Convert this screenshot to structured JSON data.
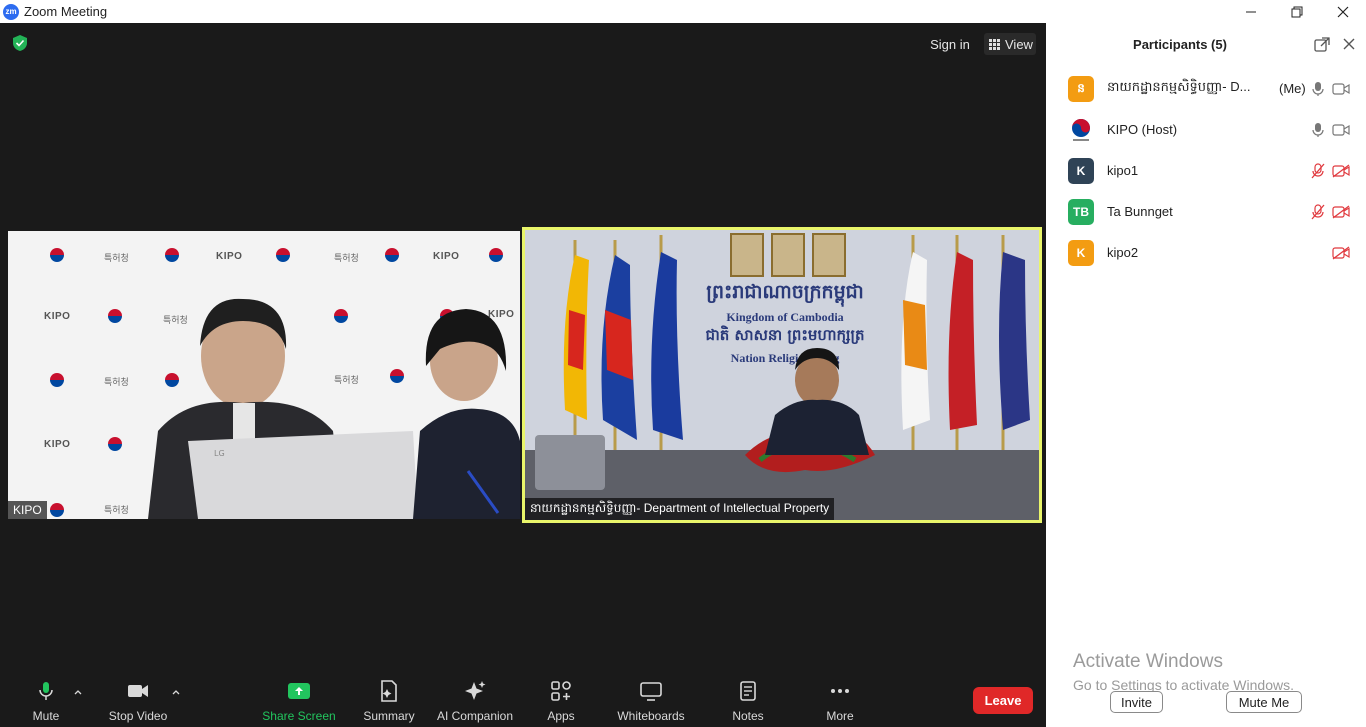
{
  "window": {
    "title": "Zoom Meeting",
    "logo_text": "zm"
  },
  "header": {
    "signin_label": "Sign in",
    "view_label": "View"
  },
  "videos": {
    "left_name": "KIPO",
    "left_backdrop_text": "KIPO",
    "left_backdrop_korean": "특허청",
    "right_name": "នាយកដ្ឋានកម្មសិទ្ធិបញ្ញា- Department of Intellectual Property",
    "right_backdrop_khmer": "ព្រះរាជាណាចក្រកម្ពុជា",
    "right_backdrop_line1": "Kingdom of Cambodia",
    "right_backdrop_khmer2": "ជាតិ សាសនា ព្រះមហាក្សត្រ",
    "right_backdrop_line2": "Nation Religion King",
    "active_speaker_color": "#e9f56a"
  },
  "toolbar": {
    "mute_label": "Mute",
    "stop_video_label": "Stop Video",
    "share_screen_label": "Share Screen",
    "summary_label": "Summary",
    "ai_companion_label": "AI Companion",
    "apps_label": "Apps",
    "whiteboards_label": "Whiteboards",
    "notes_label": "Notes",
    "more_label": "More",
    "leave_label": "Leave",
    "share_color": "#22c55e",
    "leave_color": "#e02828"
  },
  "participants_panel": {
    "title": "Participants (5)",
    "participants": [
      {
        "name": "នាយកដ្ឋានកម្មសិទ្ធិបញ្ញា- D...",
        "tag": "(Me)",
        "avatar": "ន",
        "avatar_color": "#f39c12",
        "mic": "on",
        "cam": "on"
      },
      {
        "name": "KIPO (Host)",
        "tag": "",
        "avatar": "",
        "avatar_color": "#ffffff",
        "mic": "on",
        "cam": "on"
      },
      {
        "name": "kipo1",
        "tag": "",
        "avatar": "K",
        "avatar_color": "#2f4356",
        "mic": "muted",
        "cam": "off"
      },
      {
        "name": "Ta Bunnget",
        "tag": "",
        "avatar": "TB",
        "avatar_color": "#27ae60",
        "mic": "muted",
        "cam": "off"
      },
      {
        "name": "kipo2",
        "tag": "",
        "avatar": "K",
        "avatar_color": "#f39c12",
        "mic": "none",
        "cam": "off"
      }
    ],
    "invite_label": "Invite",
    "mute_me_label": "Mute Me"
  },
  "watermark": {
    "line1": "Activate Windows",
    "line2": "Go to Settings to activate Windows."
  }
}
